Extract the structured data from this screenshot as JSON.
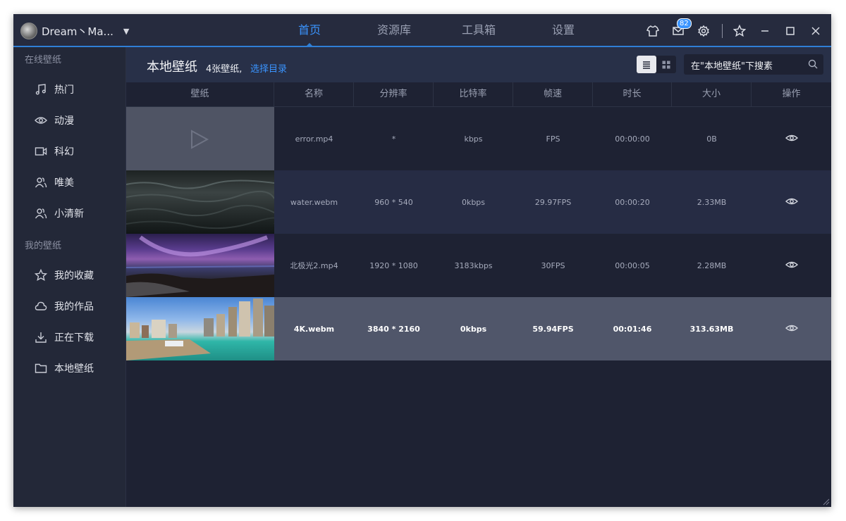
{
  "user": {
    "name": "Dream丶Ma..."
  },
  "nav": {
    "tabs": [
      "首页",
      "资源库",
      "工具箱",
      "设置"
    ],
    "active": 0
  },
  "toolbar": {
    "mail_badge": "82"
  },
  "sidebar": {
    "online_title": "在线壁纸",
    "online_items": [
      {
        "label": "热门",
        "icon": "music-icon"
      },
      {
        "label": "动漫",
        "icon": "eye-icon"
      },
      {
        "label": "科幻",
        "icon": "video-camera-icon"
      },
      {
        "label": "唯美",
        "icon": "users-icon"
      },
      {
        "label": "小清新",
        "icon": "users-icon"
      }
    ],
    "mine_title": "我的壁纸",
    "mine_items": [
      {
        "label": "我的收藏",
        "icon": "star-icon"
      },
      {
        "label": "我的作品",
        "icon": "cloud-icon"
      },
      {
        "label": "正在下载",
        "icon": "download-icon"
      },
      {
        "label": "本地壁纸",
        "icon": "folder-icon"
      }
    ]
  },
  "main": {
    "title": "本地壁纸",
    "count": "4张壁纸,",
    "choose_dir": "选择目录",
    "search_placeholder": "在\"本地壁纸\"下搜素"
  },
  "table": {
    "columns": [
      "壁纸",
      "名称",
      "分辨率",
      "比特率",
      "帧速",
      "时长",
      "大小",
      "操作"
    ],
    "rows": [
      {
        "name": "error.mp4",
        "resolution": "*",
        "bitrate": "kbps",
        "fps": "FPS",
        "duration": "00:00:00",
        "size": "0B",
        "thumb": "placeholder"
      },
      {
        "name": "water.webm",
        "resolution": "960 * 540",
        "bitrate": "0kbps",
        "fps": "29.97FPS",
        "duration": "00:00:20",
        "size": "2.33MB",
        "thumb": "water"
      },
      {
        "name": "北极光2.mp4",
        "resolution": "1920 * 1080",
        "bitrate": "3183kbps",
        "fps": "30FPS",
        "duration": "00:00:05",
        "size": "2.28MB",
        "thumb": "aurora"
      },
      {
        "name": "4K.webm",
        "resolution": "3840 * 2160",
        "bitrate": "0kbps",
        "fps": "59.94FPS",
        "duration": "00:01:46",
        "size": "313.63MB",
        "thumb": "city"
      }
    ],
    "selected_row": 3
  },
  "colors": {
    "accent": "#3a94ff",
    "bg": "#1e2233",
    "sidebar": "#232838",
    "selected_row": "#50566a",
    "alt_row": "#262c44"
  }
}
